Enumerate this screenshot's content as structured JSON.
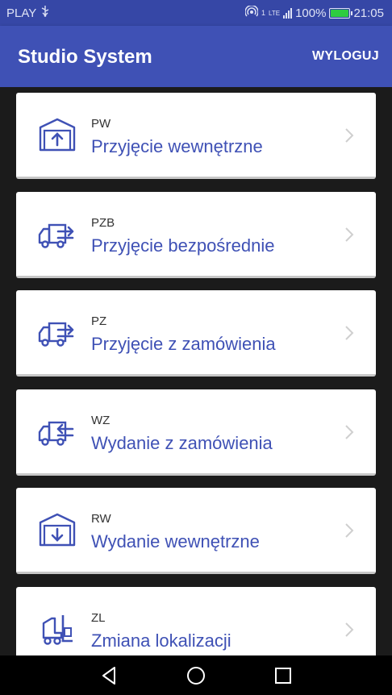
{
  "status_bar": {
    "carrier": "PLAY",
    "network": "LTE",
    "sim": "1",
    "battery": "100%",
    "battery_level": 1.0,
    "time": "21:05"
  },
  "app_bar": {
    "title": "Studio System",
    "logout_label": "WYLOGUJ"
  },
  "menu_items": [
    {
      "code": "PW",
      "label": "Przyjęcie wewnętrzne",
      "icon": "warehouse-in-icon"
    },
    {
      "code": "PZB",
      "label": "Przyjęcie bezpośrednie",
      "icon": "truck-in-icon"
    },
    {
      "code": "PZ",
      "label": "Przyjęcie z zamówienia",
      "icon": "truck-in-icon"
    },
    {
      "code": "WZ",
      "label": "Wydanie z zamówienia",
      "icon": "truck-out-icon"
    },
    {
      "code": "RW",
      "label": "Wydanie wewnętrzne",
      "icon": "warehouse-out-icon"
    },
    {
      "code": "ZL",
      "label": "Zmiana lokalizacji",
      "icon": "forklift-icon"
    }
  ],
  "colors": {
    "primary": "#3f51b5",
    "status_bar": "#3647a6",
    "accent_icon": "#3f51b5",
    "battery_fill": "#2ecc40"
  }
}
